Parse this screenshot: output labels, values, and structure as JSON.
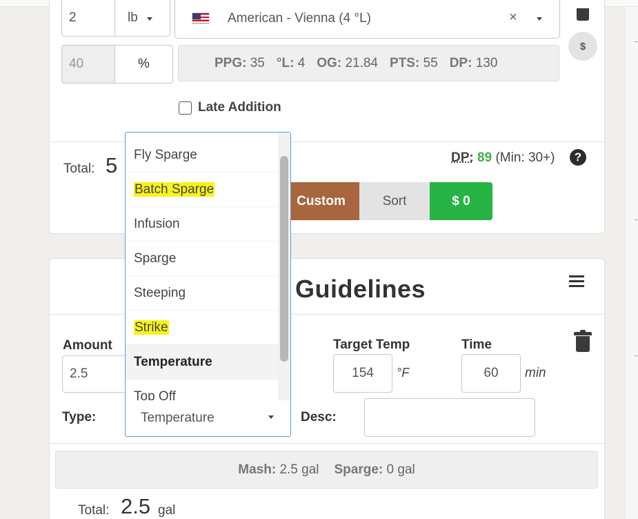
{
  "fermentable": {
    "amount_value": "2",
    "unit": "lb",
    "grain_name": "American - Vienna (4 °L)",
    "percent_value": "40",
    "percent_symbol": "%",
    "clear_symbol": "×",
    "cost_symbol": "$",
    "stats": [
      {
        "label": "PPG:",
        "value": "35"
      },
      {
        "label": "°L:",
        "value": "4"
      },
      {
        "label": "OG:",
        "value": "21.84"
      },
      {
        "label": "PTS:",
        "value": "55"
      },
      {
        "label": "DP:",
        "value": "130"
      }
    ],
    "late_addition_label": "Late Addition"
  },
  "totals_row": {
    "total_label": "Total:",
    "total_value_partial": "5",
    "dp_label": "DP:",
    "dp_value": "89",
    "dp_min": "(Min: 30+)",
    "help_symbol": "?"
  },
  "buttons": {
    "custom_label": "Custom",
    "sort_label": "Sort",
    "cost_label": "$ 0",
    "colors": {
      "custom": "#a9653e",
      "sort": "#e3e3e3",
      "cost": "#27b445"
    }
  },
  "mash": {
    "title_partial": "Guidelines",
    "amount_label": "Amount",
    "amount_value": "2.5",
    "target_temp_label": "Target Temp",
    "target_temp_value": "154",
    "temp_unit": "°F",
    "time_label": "Time",
    "time_value": "60",
    "time_unit": "min",
    "type_label": "Type:",
    "desc_label": "Desc:",
    "desc_value": "",
    "summary_mash_label": "Mash:",
    "summary_mash_value": "2.5 gal",
    "summary_sparge_label": "Sparge:",
    "summary_sparge_value": "0 gal",
    "total_label": "Total:",
    "total_value": "2.5",
    "total_unit": "gal"
  },
  "dropdown": {
    "options": [
      "Fly Sparge",
      "Batch Sparge",
      "Infusion",
      "Sparge",
      "Steeping",
      "Strike",
      "Temperature",
      "Top Off"
    ],
    "highlighted": [
      "Batch Sparge",
      "Strike"
    ],
    "selected": "Temperature",
    "highlight_color": "#f8f31a",
    "border_color": "#5b9bd5"
  }
}
